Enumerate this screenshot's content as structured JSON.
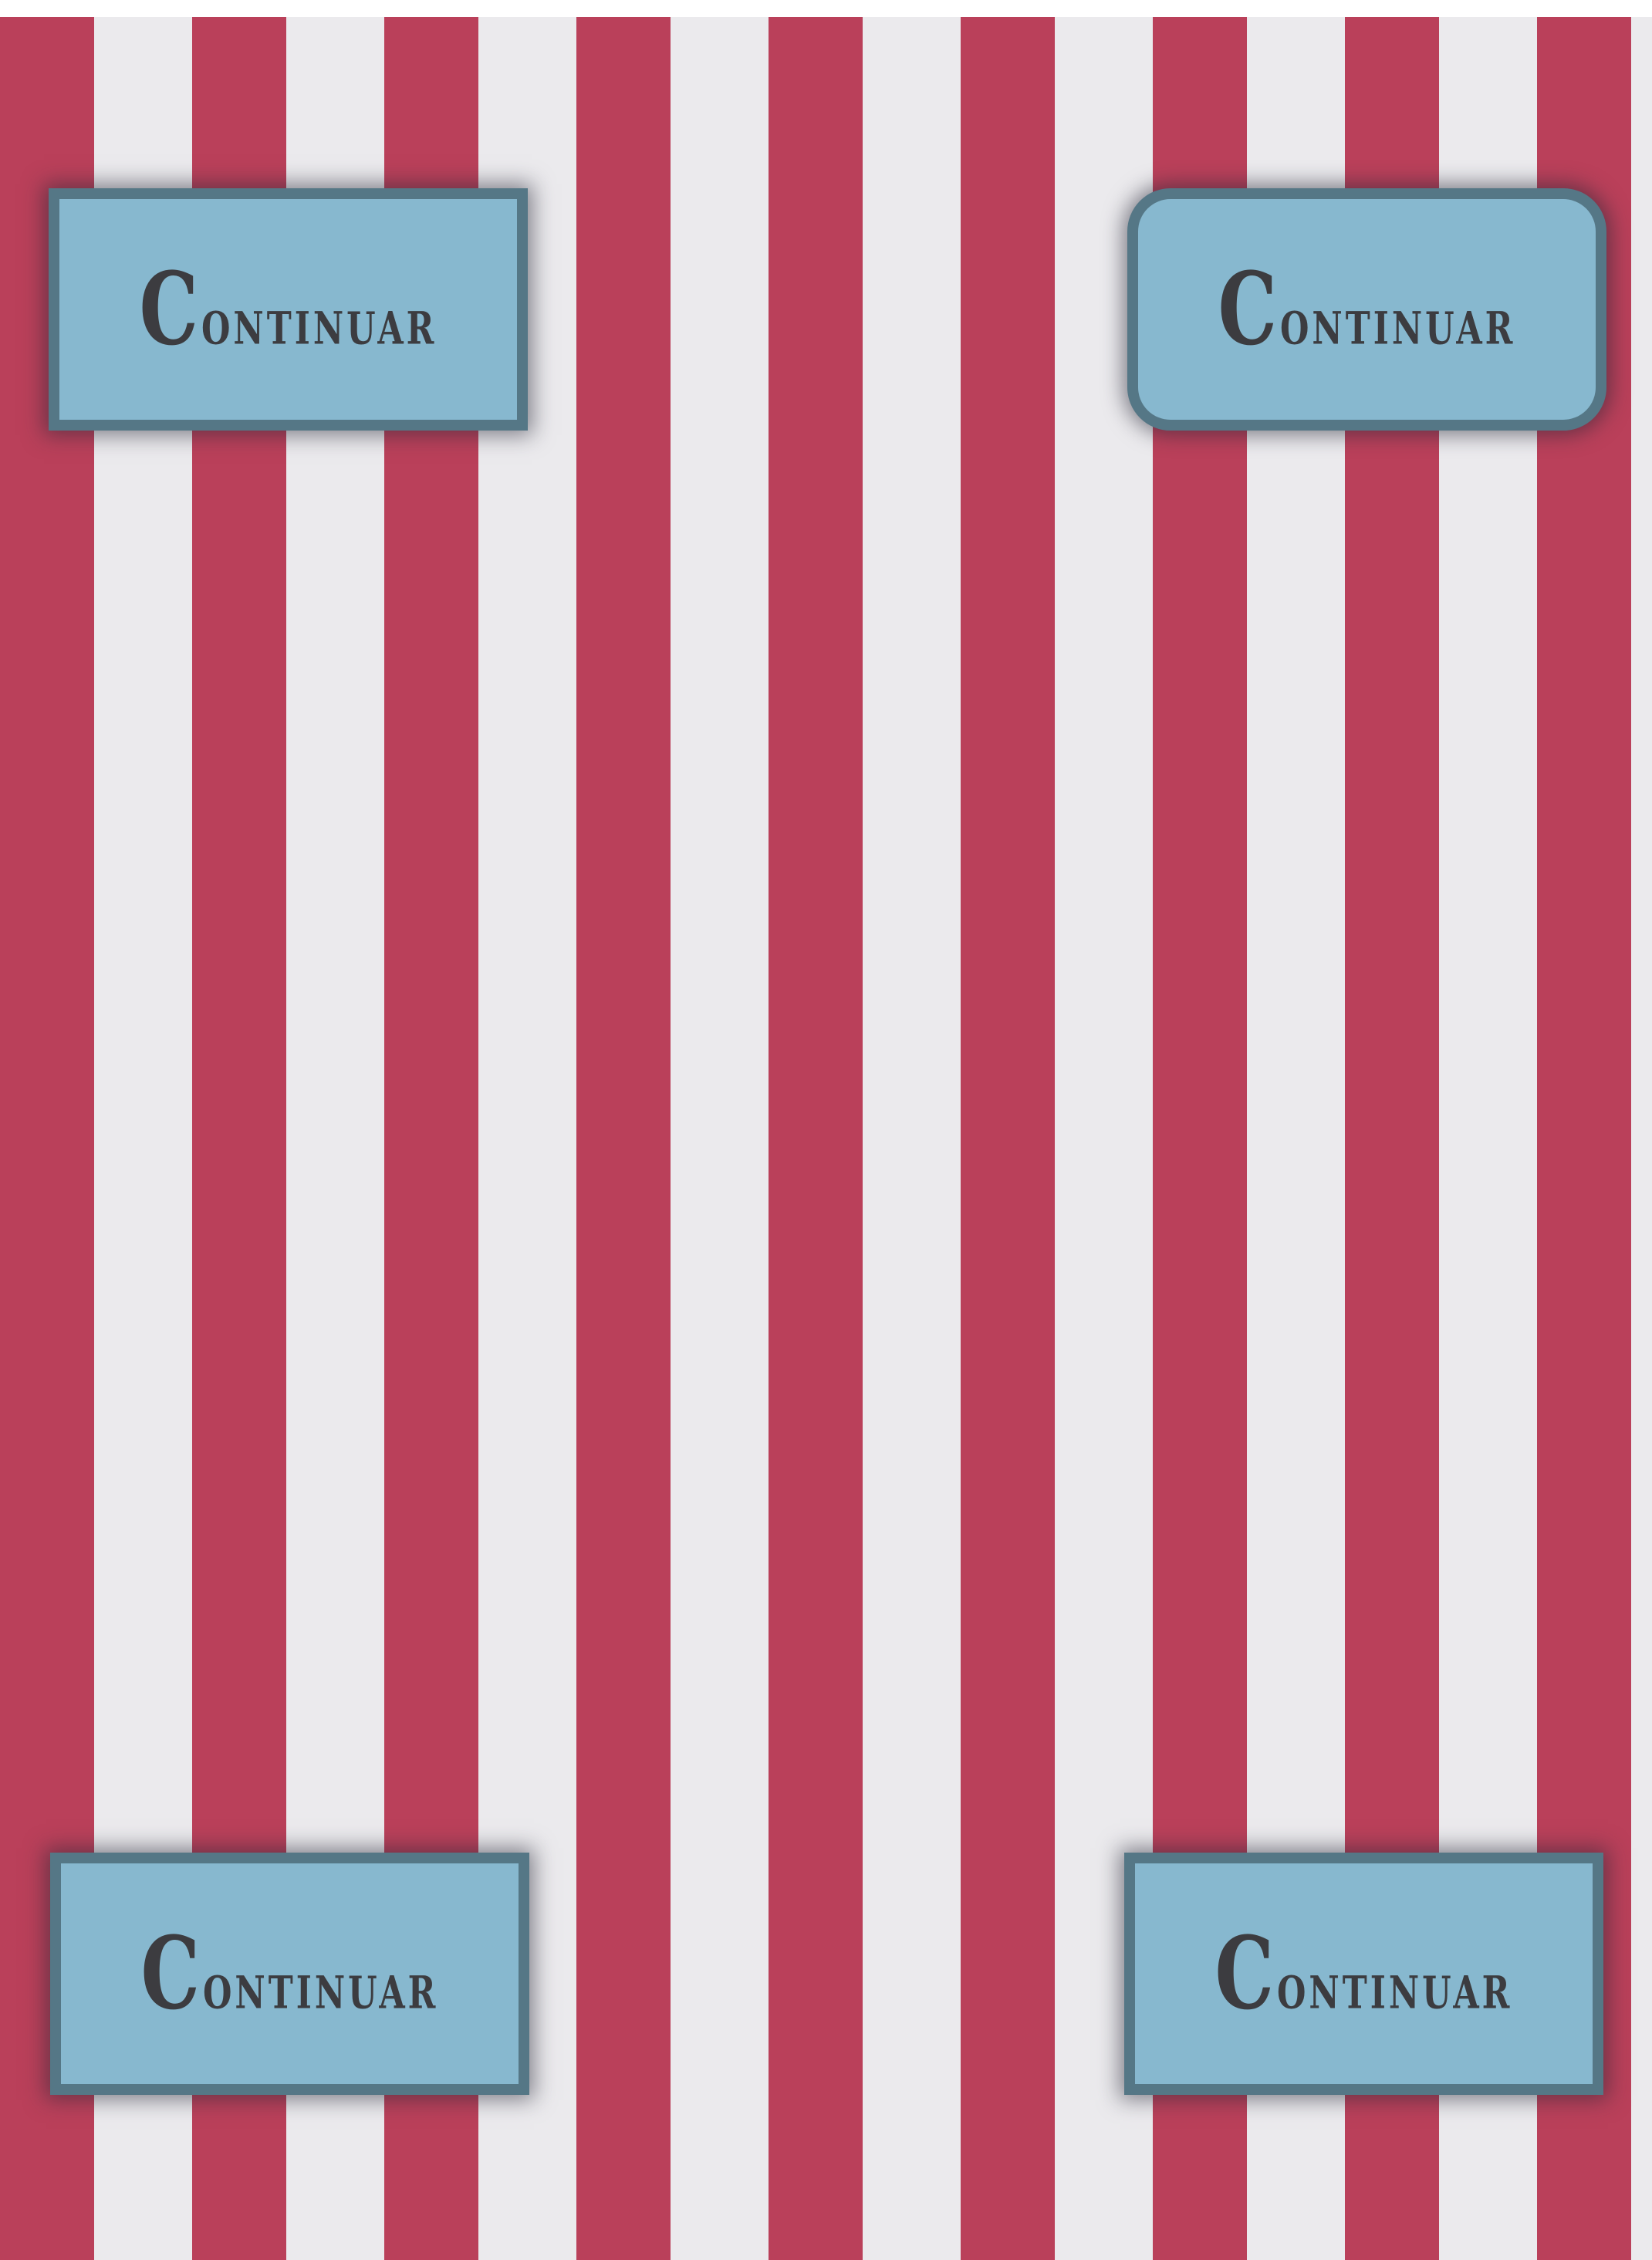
{
  "theme": {
    "stripe_red": "#ba405a",
    "stripe_white": "#ebeaed",
    "button_fill": "#87b8cf",
    "button_border": "#557786",
    "label_color": "#3c3c40"
  },
  "buttons": [
    {
      "label": "Continuar",
      "shape": "square"
    },
    {
      "label": "Continuar",
      "shape": "rounded"
    },
    {
      "label": "Continuar",
      "shape": "square"
    },
    {
      "label": "Continuar",
      "shape": "square"
    }
  ]
}
